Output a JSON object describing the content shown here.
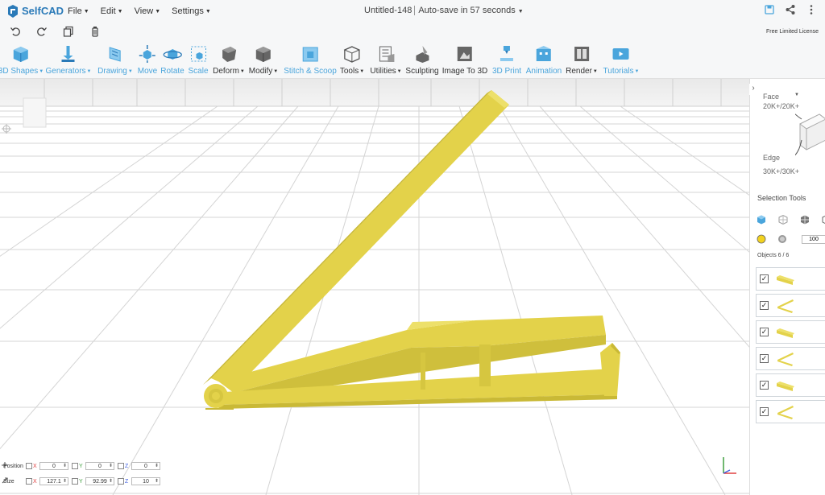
{
  "app": {
    "name": "SelfCAD"
  },
  "menu": [
    {
      "label": "File"
    },
    {
      "label": "Edit"
    },
    {
      "label": "View"
    },
    {
      "label": "Settings"
    }
  ],
  "document": {
    "title": "Untitled-148",
    "autosave": "Auto-save in 57 seconds"
  },
  "license": "Free Limited License",
  "toolbar": [
    {
      "label": "3D Shapes",
      "icon": "cube-icon",
      "dropdown": true,
      "blue": true
    },
    {
      "label": "Generators",
      "icon": "generator-pin-icon",
      "dropdown": true,
      "blue": true
    },
    {
      "label": "Drawing",
      "icon": "pencil-icon",
      "dropdown": true,
      "blue": true
    },
    {
      "label": "Move",
      "icon": "move-icon",
      "dropdown": false,
      "blue": true
    },
    {
      "label": "Rotate",
      "icon": "rotate-icon",
      "dropdown": false,
      "blue": true
    },
    {
      "label": "Scale",
      "icon": "scale-icon",
      "dropdown": false,
      "blue": true
    },
    {
      "label": "Deform",
      "icon": "deform-icon",
      "dropdown": true,
      "blue": false
    },
    {
      "label": "Modify",
      "icon": "modify-icon",
      "dropdown": true,
      "blue": false
    },
    {
      "label": "Stitch & Scoop",
      "icon": "stitch-scoop-icon",
      "dropdown": false,
      "blue": true
    },
    {
      "label": "Tools",
      "icon": "tools-icon",
      "dropdown": true,
      "blue": false
    },
    {
      "label": "Utilities",
      "icon": "utilities-icon",
      "dropdown": true,
      "blue": false
    },
    {
      "label": "Sculpting",
      "icon": "sculpting-icon",
      "dropdown": false,
      "blue": false
    },
    {
      "label": "Image To 3D",
      "icon": "image-to-3d-icon",
      "dropdown": false,
      "blue": false
    },
    {
      "label": "3D Print",
      "icon": "3d-print-icon",
      "dropdown": false,
      "blue": true
    },
    {
      "label": "Animation",
      "icon": "animation-icon",
      "dropdown": false,
      "blue": true
    },
    {
      "label": "Render",
      "icon": "render-icon",
      "dropdown": true,
      "blue": false
    },
    {
      "label": "Tutorials",
      "icon": "tutorials-icon",
      "dropdown": true,
      "blue": true
    }
  ],
  "transform": {
    "position": {
      "label": "Position",
      "x": "0",
      "y": "0",
      "z": "0"
    },
    "size": {
      "label": "Size",
      "x": "127.1",
      "y": "92.99",
      "z": "10"
    }
  },
  "right_panel": {
    "face_label": "Face",
    "face_count": "20K+/20K+",
    "edge_label": "Edge",
    "edge_count": "30K+/30K+",
    "selection_tools_title": "Selection Tools",
    "selection_size": "100",
    "objects_count": "Objects 6 / 6",
    "objects": [
      {
        "checked": true,
        "thumb": "bar"
      },
      {
        "checked": true,
        "thumb": "v"
      },
      {
        "checked": true,
        "thumb": "bar"
      },
      {
        "checked": true,
        "thumb": "v"
      },
      {
        "checked": true,
        "thumb": "bar"
      },
      {
        "checked": true,
        "thumb": "v"
      }
    ]
  },
  "colors": {
    "accent": "#4aa5dc",
    "model": "#e3d24a",
    "model_dark": "#c9b936",
    "model_light": "#ede06a"
  }
}
